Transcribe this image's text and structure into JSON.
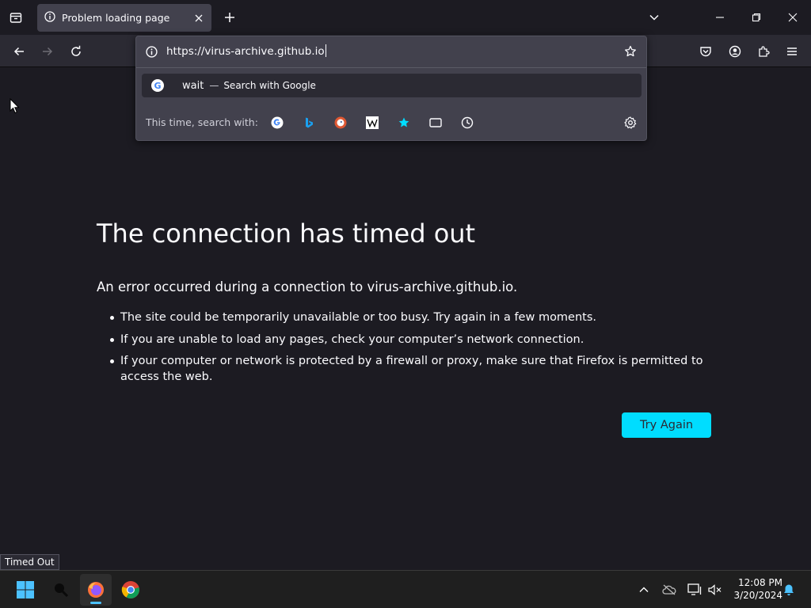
{
  "tab": {
    "title": "Problem loading page"
  },
  "address_bar": {
    "url": "https://virus-archive.github.io"
  },
  "suggestion": {
    "term": "wait",
    "separator": "—",
    "action": "Search with Google",
    "engine_icon": "google-icon"
  },
  "one_off": {
    "label": "This time, search with:",
    "engines": [
      "google-icon",
      "bing-icon",
      "duckduckgo-icon",
      "wikipedia-icon",
      "bookmarks-icon",
      "tabs-icon",
      "history-icon"
    ]
  },
  "error": {
    "title": "The connection has timed out",
    "description": "An error occurred during a connection to virus-archive.github.io.",
    "items": [
      "The site could be temporarily unavailable or too busy. Try again in a few moments.",
      "If you are unable to load any pages, check your computer’s network connection.",
      "If your computer or network is protected by a firewall or proxy, make sure that Firefox is permitted to access the web."
    ],
    "button": "Try Again"
  },
  "status_bar": {
    "text": "Timed Out"
  },
  "taskbar": {
    "time": "12:08 PM",
    "date": "3/20/2024"
  },
  "colors": {
    "accent": "#00ddff",
    "background": "#1c1b22",
    "toolbar": "#2b2a33",
    "popup": "#42414d"
  }
}
